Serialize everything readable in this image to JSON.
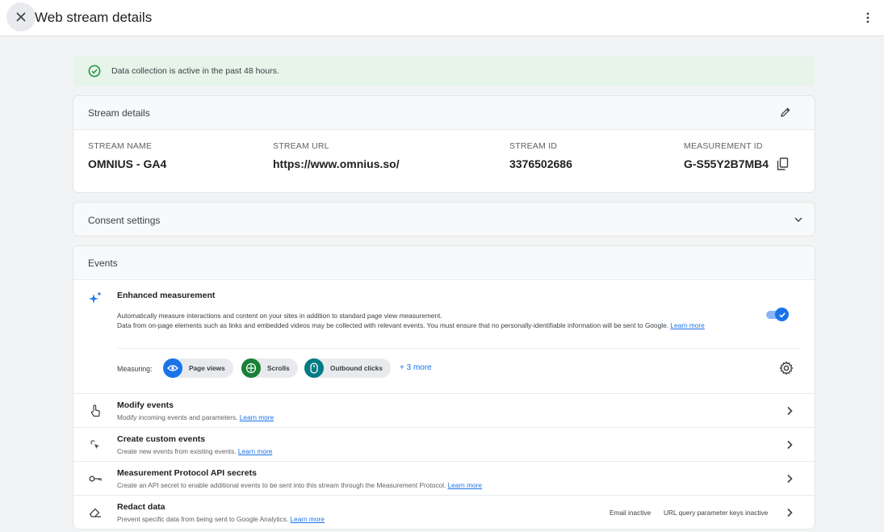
{
  "header": {
    "title": "Web stream details"
  },
  "banner": {
    "text": "Data collection is active in the past 48 hours."
  },
  "stream_details": {
    "heading": "Stream details",
    "columns": [
      {
        "label": "STREAM NAME",
        "value": "OMNIUS - GA4"
      },
      {
        "label": "STREAM URL",
        "value": "https://www.omnius.so/"
      },
      {
        "label": "STREAM ID",
        "value": "3376502686"
      },
      {
        "label": "MEASUREMENT ID",
        "value": "G-S55Y2B7MB4"
      }
    ]
  },
  "consent": {
    "heading": "Consent settings"
  },
  "events": {
    "heading": "Events",
    "enhanced": {
      "title": "Enhanced measurement",
      "desc_line1": "Automatically measure interactions and content on your sites in addition to standard page view measurement.",
      "desc_line2": "Data from on-page elements such as links and embedded videos may be collected with relevant events. You must ensure that no personally-identifiable information will be sent to Google.",
      "learn_more": "Learn more",
      "toggle_on": true,
      "measuring_label": "Measuring:",
      "chips": [
        "Page views",
        "Scrolls",
        "Outbound clicks"
      ],
      "more": "+ 3 more"
    },
    "rows": [
      {
        "title": "Modify events",
        "desc": "Modify incoming events and parameters.",
        "link": "Learn more",
        "icon": "touch-icon"
      },
      {
        "title": "Create custom events",
        "desc": "Create new events from existing events.",
        "link": "Learn more",
        "icon": "sparkle-click-icon"
      },
      {
        "title": "Measurement Protocol API secrets",
        "desc": "Create an API secret to enable additional events to be sent into this stream through the Measurement Protocol.",
        "link": "Learn more",
        "icon": "key-icon"
      },
      {
        "title": "Redact data",
        "desc": "Prevent specific data from being sent to Google Analytics.",
        "link": "Learn more",
        "icon": "eraser-icon",
        "status1": "Email inactive",
        "status2": "URL query parameter keys inactive"
      }
    ]
  },
  "colors": {
    "accent": "#1a73e8",
    "success_bg": "#e6f4ea",
    "success": "#1e8e3e",
    "chip_blue": "#1a73e8",
    "chip_green": "#188038",
    "chip_teal": "#007b83"
  }
}
